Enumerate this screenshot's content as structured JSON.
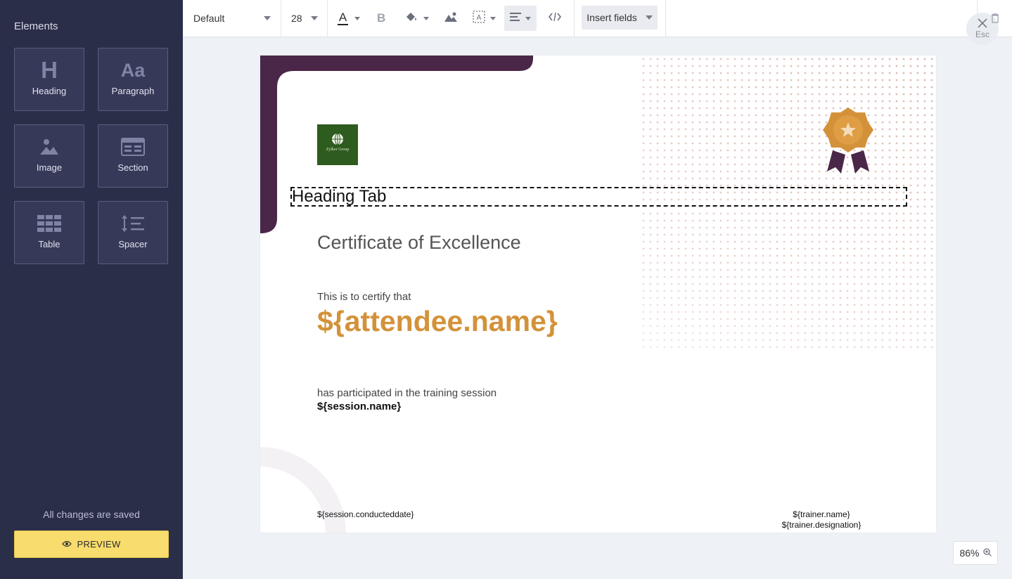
{
  "sidebar": {
    "title": "Elements",
    "tiles": [
      {
        "label": "Heading",
        "icon": "heading-icon"
      },
      {
        "label": "Paragraph",
        "icon": "paragraph-icon"
      },
      {
        "label": "Image",
        "icon": "image-icon"
      },
      {
        "label": "Section",
        "icon": "section-icon"
      },
      {
        "label": "Table",
        "icon": "table-icon"
      },
      {
        "label": "Spacer",
        "icon": "spacer-icon"
      }
    ],
    "heading_glyph": "H",
    "paragraph_glyph": "Aa",
    "save_status": "All changes are saved",
    "preview_label": "PREVIEW"
  },
  "toolbar": {
    "font_family": "Default",
    "font_size": "28",
    "text_color_glyph": "A",
    "bold_glyph": "B",
    "insert_fields_label": "Insert fields",
    "close_hint": "Esc"
  },
  "certificate": {
    "logo_text": "Zylker Group",
    "heading_tab": "Heading Tab",
    "title": "Certificate of Excellence",
    "certify_line": "This is to certify that",
    "attendee_placeholder": "${attendee.name}",
    "participated_line": "has participated in the training session",
    "session_placeholder": "${session.name}",
    "conducted_date_placeholder": "${session.conducteddate}",
    "trainer_name_placeholder": "${trainer.name}",
    "trainer_designation_placeholder": "${trainer.designation}"
  },
  "zoom": {
    "level": "86%"
  },
  "colors": {
    "sidebar_bg": "#2b2e48",
    "preview_button": "#f8dc6d",
    "accent_orange": "#d3923a",
    "accent_purple": "#4a2749",
    "logo_green": "#2e5b1e"
  }
}
